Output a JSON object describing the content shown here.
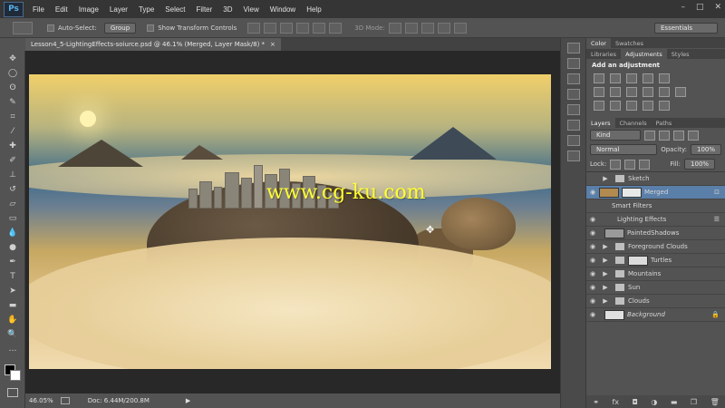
{
  "app": {
    "logo": "Ps"
  },
  "menu": [
    "File",
    "Edit",
    "Image",
    "Layer",
    "Type",
    "Select",
    "Filter",
    "3D",
    "View",
    "Window",
    "Help"
  ],
  "window_controls": [
    "–",
    "□",
    "✕"
  ],
  "options_bar": {
    "auto_select_label": "Auto-Select:",
    "auto_select_value": "Group",
    "transform_label": "Show Transform Controls",
    "mode_label": "3D Mode:",
    "workspace": "Essentials"
  },
  "document": {
    "tab_title": "Lesson4_5-LightingEffects-soiurce.psd @ 46.1% (Merged, Layer Mask/8) *",
    "close": "×",
    "watermark": "www.cg-ku.com"
  },
  "status": {
    "zoom": "46.05%",
    "doc": "Doc: 6.44M/200.8M"
  },
  "panels": {
    "top_tabs": [
      "Color",
      "Swatches"
    ],
    "mid_tabs": [
      "Libraries",
      "Adjustments",
      "Styles"
    ],
    "adjustments_title": "Add an adjustment",
    "layers_tabs": [
      "Layers",
      "Channels",
      "Paths"
    ],
    "kind_label": "Kind",
    "blend_mode": "Normal",
    "opacity_label": "Opacity:",
    "opacity_value": "100%",
    "lock_label": "Lock:",
    "fill_label": "Fill:",
    "fill_value": "100%"
  },
  "layers": [
    {
      "name": "Sketch",
      "type": "folder",
      "visible": false
    },
    {
      "name": "Merged",
      "type": "layer",
      "visible": true,
      "selected": true
    },
    {
      "name": "Smart Filters",
      "type": "sub",
      "visible": false
    },
    {
      "name": "Lighting Effects",
      "type": "sub",
      "visible": true
    },
    {
      "name": "PaintedShadows",
      "type": "layer",
      "visible": true
    },
    {
      "name": "Foreground Clouds",
      "type": "folder",
      "visible": true
    },
    {
      "name": "Turtles",
      "type": "folder",
      "visible": true
    },
    {
      "name": "Mountains",
      "type": "folder",
      "visible": true
    },
    {
      "name": "Sun",
      "type": "folder",
      "visible": true
    },
    {
      "name": "Clouds",
      "type": "folder",
      "visible": true
    },
    {
      "name": "Background",
      "type": "layer",
      "visible": true
    }
  ],
  "colors": {
    "menubar": "#353535",
    "panel": "#535353",
    "selected": "#5a7fa8",
    "watermark": "#ffff33"
  }
}
